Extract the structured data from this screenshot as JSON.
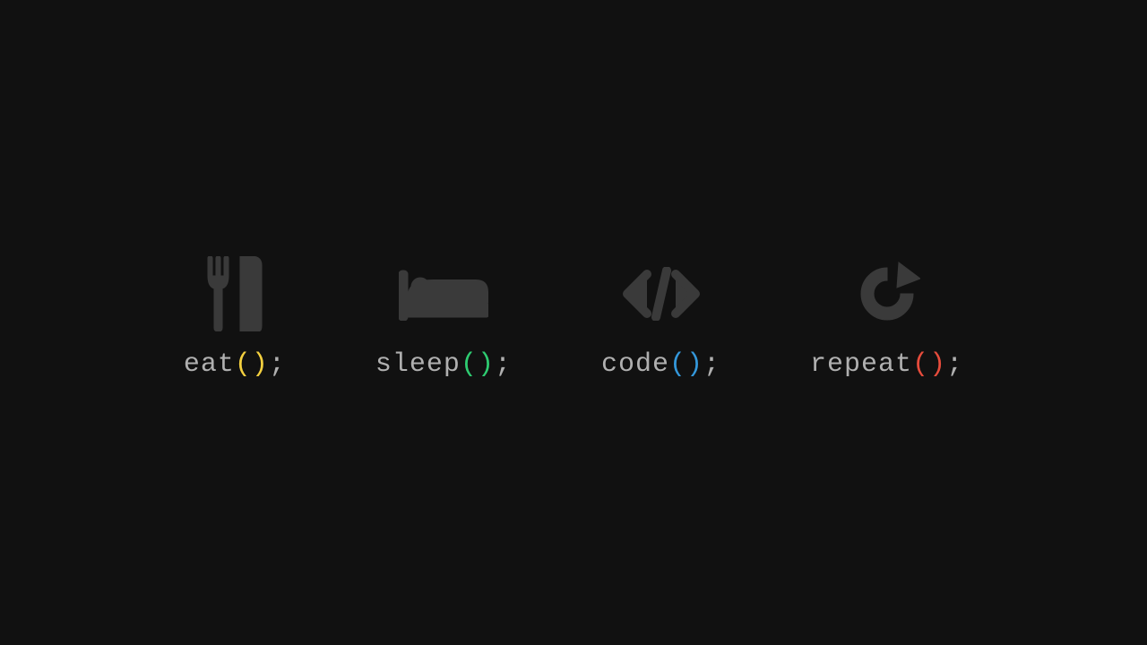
{
  "colors": {
    "background": "#111111",
    "icon": "#3a3a3a",
    "text": "#b0b0b0",
    "paren_yellow": "#f4d03f",
    "paren_green": "#2ecc71",
    "paren_blue": "#3498db",
    "paren_red": "#e74c3c"
  },
  "items": [
    {
      "icon": "cutlery",
      "fn": "eat",
      "paren_color": "#f4d03f"
    },
    {
      "icon": "bed",
      "fn": "sleep",
      "paren_color": "#2ecc71"
    },
    {
      "icon": "code",
      "fn": "code",
      "paren_color": "#3498db"
    },
    {
      "icon": "repeat",
      "fn": "repeat",
      "paren_color": "#e74c3c"
    }
  ],
  "suffix": ";"
}
